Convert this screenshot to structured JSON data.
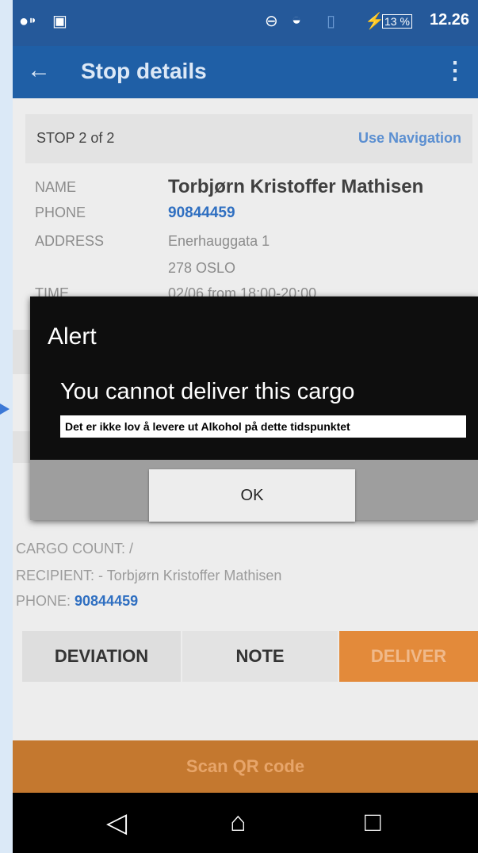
{
  "status_bar": {
    "battery_percent": "13 %",
    "time": "12.26",
    "charging_symbol": "⚡"
  },
  "app_bar": {
    "title": "Stop details"
  },
  "stop": {
    "label": "STOP 2 of 2",
    "navigation_link": "Use Navigation",
    "fields": {
      "name_label": "NAME",
      "name_value": "Torbjørn Kristoffer Mathisen",
      "phone_label": "PHONE",
      "phone_value": "90844459",
      "address_label": "ADDRESS",
      "address_line1": "Enerhauggata 1",
      "address_line2": "278 OSLO",
      "time_label": "TIME",
      "time_value": "02/06 from 18:00-20:00"
    }
  },
  "cargo": {
    "count_line": "CARGO COUNT: /",
    "recipient_line": "RECIPIENT: - Torbjørn Kristoffer Mathisen",
    "phone_prefix": "PHONE: ",
    "phone_value": "90844459"
  },
  "actions": {
    "deviation_label": "DEVIATION",
    "note_label": "NOTE",
    "deliver_label": "DELIVER",
    "scan_label": "Scan QR code"
  },
  "dialog": {
    "title": "Alert",
    "message": "You cannot deliver this cargo",
    "note": "Det er ikke lov å levere ut Alkohol på dette tidspunktet",
    "ok_label": "OK"
  },
  "icons": {
    "back": "arrow-left-icon",
    "menu": "overflow-menu-icon",
    "nav_back": "nav-back-icon",
    "nav_home": "nav-home-icon",
    "nav_recents": "nav-recents-icon"
  },
  "colors": {
    "app_bar": "#1f5fa6",
    "status_bar": "#25599a",
    "deliver": "#e38a3a",
    "scan": "#c4782f",
    "link": "#2f6fc1"
  }
}
